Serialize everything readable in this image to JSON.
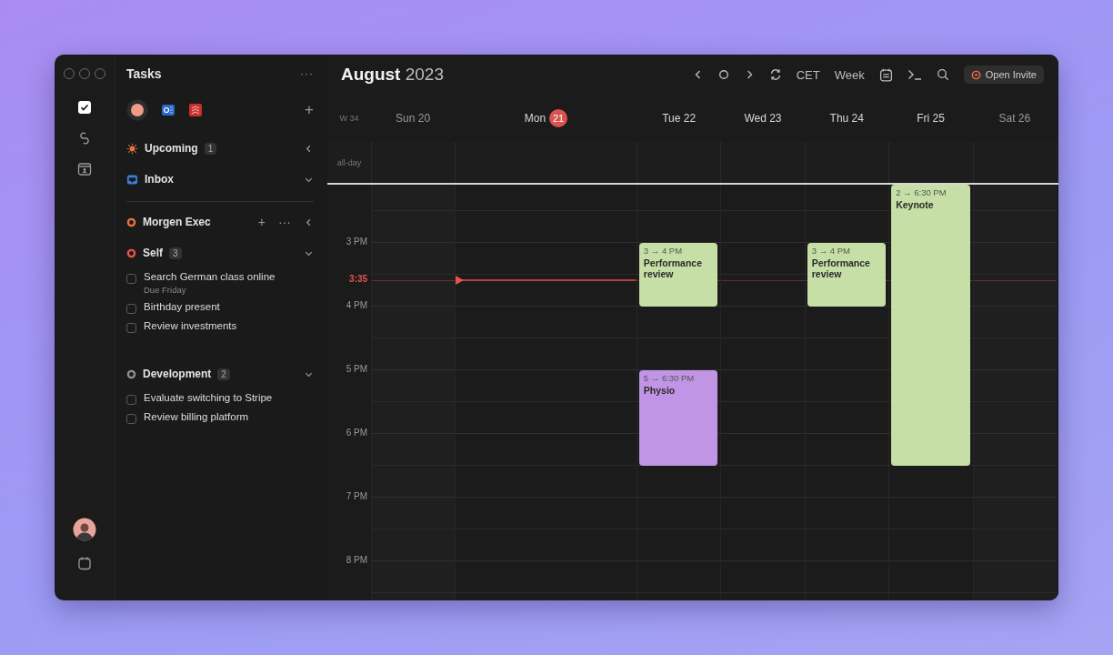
{
  "sidebar": {
    "title": "Tasks",
    "more": "···",
    "add": "+"
  },
  "sections": [
    {
      "kind": "upcoming",
      "name": "Upcoming",
      "count": "1",
      "expanded": false,
      "color": "#e8743b"
    },
    {
      "kind": "inbox",
      "name": "Inbox",
      "expanded": true,
      "color": "#3d7fd6"
    },
    {
      "kind": "list",
      "name": "Morgen Exec",
      "expanded": false,
      "actions": [
        "+",
        "···"
      ],
      "color": "#e8743b"
    },
    {
      "kind": "list",
      "name": "Self",
      "count": "3",
      "expanded": true,
      "color": "#e5534b",
      "tasks": [
        {
          "title": "Search German class online",
          "due": "Due Friday",
          "checked": false
        },
        {
          "title": "Birthday present",
          "checked": false
        },
        {
          "title": "Review investments",
          "checked": false
        }
      ]
    },
    {
      "kind": "list",
      "name": "Development",
      "count": "2",
      "expanded": true,
      "color": "#8e8e8e",
      "tasks": [
        {
          "title": "Evaluate switching to Stripe",
          "checked": false
        },
        {
          "title": "Review billing platform",
          "checked": false
        }
      ]
    }
  ],
  "header": {
    "month": "August",
    "year": "2023",
    "timezone": "CET",
    "view": "Week",
    "invite": "Open Invite"
  },
  "week": "W 34",
  "allday": "all-day",
  "days": [
    {
      "name": "Sun",
      "date": "20",
      "today": false,
      "weekend": true
    },
    {
      "name": "Mon",
      "date": "21",
      "today": true,
      "weekend": false
    },
    {
      "name": "Tue",
      "date": "22",
      "today": false,
      "weekend": false,
      "events": [
        {
          "title": "Performance review",
          "time": "3 → 4 PM",
          "color": "#c6dfa6"
        },
        {
          "title": "Physio",
          "time": "5 → 6:30 PM",
          "color": "#c195e6"
        }
      ]
    },
    {
      "name": "Wed",
      "date": "23",
      "today": false,
      "weekend": false
    },
    {
      "name": "Thu",
      "date": "24",
      "today": false,
      "weekend": false,
      "events": [
        {
          "title": "Performance review",
          "time": "3 → 4 PM",
          "color": "#c6dfa6"
        }
      ]
    },
    {
      "name": "Fri",
      "date": "25",
      "today": false,
      "weekend": false,
      "events": [
        {
          "title": "Keynote",
          "time": "2 → 6:30 PM",
          "color": "#c6dfa6"
        }
      ]
    },
    {
      "name": "Sat",
      "date": "26",
      "today": false,
      "weekend": true
    }
  ],
  "hours": [
    "3 PM",
    "4 PM",
    "5 PM",
    "6 PM",
    "7 PM",
    "8 PM"
  ],
  "now": "3:35"
}
